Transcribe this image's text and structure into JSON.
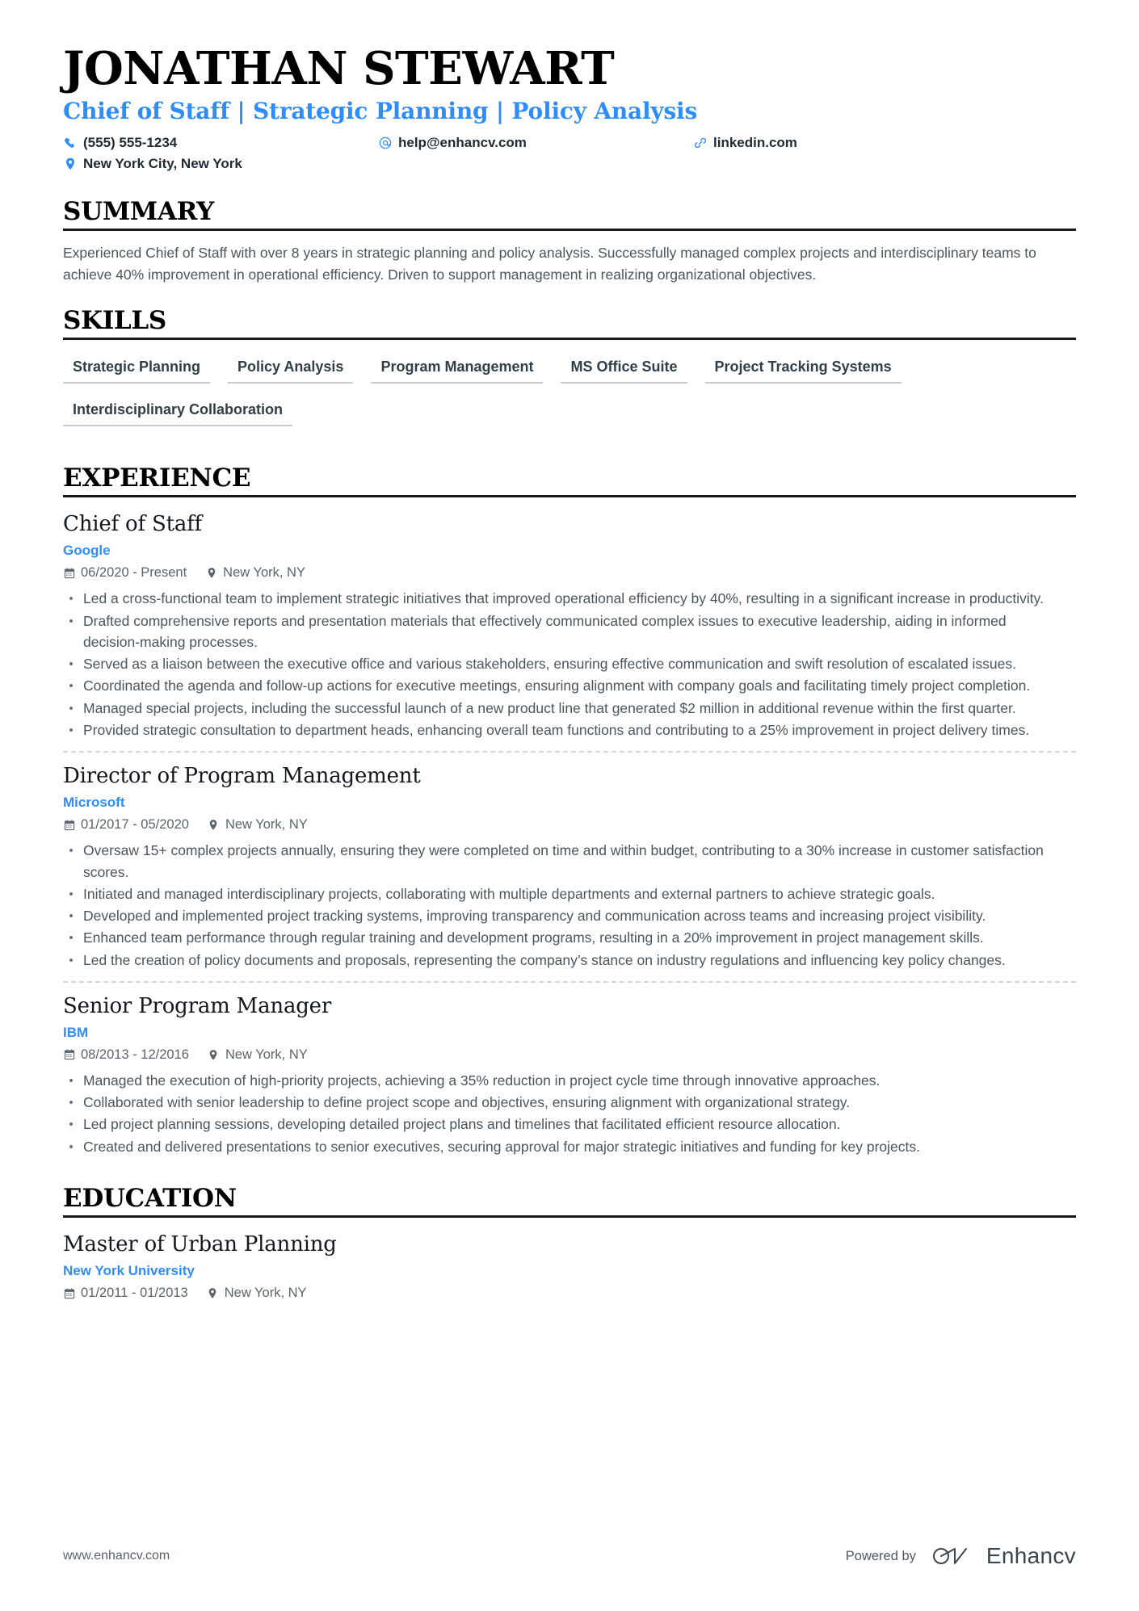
{
  "header": {
    "full_name": "JONATHAN STEWART",
    "headline": "Chief of Staff | Strategic Planning | Policy Analysis",
    "contacts": {
      "phone": "(555) 555-1234",
      "email": "help@enhancv.com",
      "link": "linkedin.com",
      "location": "New York City, New York"
    }
  },
  "sections": {
    "summary": {
      "title": "SUMMARY",
      "text": "Experienced Chief of Staff with over 8 years in strategic planning and policy analysis. Successfully managed complex projects and interdisciplinary teams to achieve 40% improvement in operational efficiency. Driven to support management in realizing organizational objectives."
    },
    "skills": {
      "title": "SKILLS",
      "items": [
        "Strategic Planning",
        "Policy Analysis",
        "Program Management",
        "MS Office Suite",
        "Project Tracking Systems",
        "Interdisciplinary Collaboration"
      ]
    },
    "experience": {
      "title": "EXPERIENCE",
      "entries": [
        {
          "title": "Chief of Staff",
          "org": "Google",
          "dates": "06/2020 - Present",
          "location": "New York, NY",
          "bullets": [
            "Led a cross-functional team to implement strategic initiatives that improved operational efficiency by 40%, resulting in a significant increase in productivity.",
            "Drafted comprehensive reports and presentation materials that effectively communicated complex issues to executive leadership, aiding in informed decision-making processes.",
            "Served as a liaison between the executive office and various stakeholders, ensuring effective communication and swift resolution of escalated issues.",
            "Coordinated the agenda and follow-up actions for executive meetings, ensuring alignment with company goals and facilitating timely project completion.",
            "Managed special projects, including the successful launch of a new product line that generated $2 million in additional revenue within the first quarter.",
            "Provided strategic consultation to department heads, enhancing overall team functions and contributing to a 25% improvement in project delivery times."
          ]
        },
        {
          "title": "Director of Program Management",
          "org": "Microsoft",
          "dates": "01/2017 - 05/2020",
          "location": "New York, NY",
          "bullets": [
            "Oversaw 15+ complex projects annually, ensuring they were completed on time and within budget, contributing to a 30% increase in customer satisfaction scores.",
            "Initiated and managed interdisciplinary projects, collaborating with multiple departments and external partners to achieve strategic goals.",
            "Developed and implemented project tracking systems, improving transparency and communication across teams and increasing project visibility.",
            "Enhanced team performance through regular training and development programs, resulting in a 20% improvement in project management skills.",
            "Led the creation of policy documents and proposals, representing the company’s stance on industry regulations and influencing key policy changes."
          ]
        },
        {
          "title": "Senior Program Manager",
          "org": "IBM",
          "dates": "08/2013 - 12/2016",
          "location": "New York, NY",
          "bullets": [
            "Managed the execution of high-priority projects, achieving a 35% reduction in project cycle time through innovative approaches.",
            "Collaborated with senior leadership to define project scope and objectives, ensuring alignment with organizational strategy.",
            "Led project planning sessions, developing detailed project plans and timelines that facilitated efficient resource allocation.",
            "Created and delivered presentations to senior executives, securing approval for major strategic initiatives and funding for key projects."
          ]
        }
      ]
    },
    "education": {
      "title": "EDUCATION",
      "entries": [
        {
          "title": "Master of Urban Planning",
          "org": "New York University",
          "dates": "01/2011 - 01/2013",
          "location": "New York, NY"
        }
      ]
    }
  },
  "footer": {
    "url": "www.enhancv.com",
    "powered_by": "Powered by",
    "brand": "Enhancv"
  },
  "colors": {
    "accent": "#2f8dfa",
    "rule": "#16191c",
    "body_text": "#4a555e",
    "chip_underline": "#c9cdd1"
  }
}
